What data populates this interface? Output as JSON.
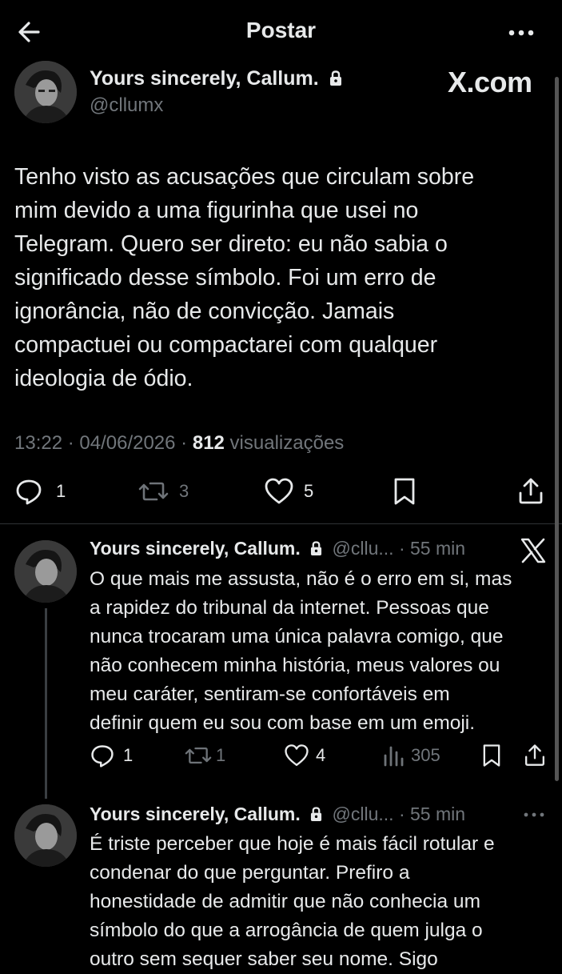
{
  "header": {
    "title": "Postar"
  },
  "brand": {
    "logo_text": "X.com"
  },
  "main_post": {
    "author_name": "Yours sincerely, Callum.",
    "handle": "@cllumx",
    "text_lines": [
      "Tenho visto as acusações que circulam sobre",
      "mim devido a uma figurinha que usei no",
      "Telegram. Quero ser direto: eu não sabia o",
      "significado desse símbolo. Foi um erro de",
      "ignorância, não de convicção. Jamais",
      "compactuei ou compactarei com qualquer",
      "ideologia de ódio."
    ],
    "timestamp": "13:22 · 04/06/2026 · ",
    "views_count": "812",
    "views_label": " visualizações",
    "replies": "1",
    "reposts": "3",
    "likes": "5"
  },
  "replies": [
    {
      "author_name": "Yours sincerely, Callum.",
      "handle_time": "@cllu... · 55 min",
      "text_lines": [
        "O que mais me assusta, não é o erro em si, mas",
        "a rapidez do tribunal da internet. Pessoas que",
        "nunca trocaram uma única palavra comigo, que",
        "não conhecem minha história, meus valores ou",
        "meu caráter, sentiram-se confortáveis em",
        "definir quem eu sou com base em um emoji."
      ],
      "replies": "1",
      "reposts": "1",
      "likes": "4",
      "views": "305"
    },
    {
      "author_name": "Yours sincerely, Callum.",
      "handle_time": "@cllu... · 55 min",
      "text_lines": [
        "É triste perceber que hoje é mais fácil rotular e",
        "condenar do que perguntar. Prefiro a",
        "honestidade de admitir que não conhecia um",
        "símbolo do que a arrogância de quem julga o",
        "outro sem sequer saber seu nome. Sigo"
      ]
    }
  ],
  "colors": {
    "background": "#000000",
    "text": "#e7e9ea",
    "muted": "#71767b",
    "divider": "#2f3336"
  }
}
